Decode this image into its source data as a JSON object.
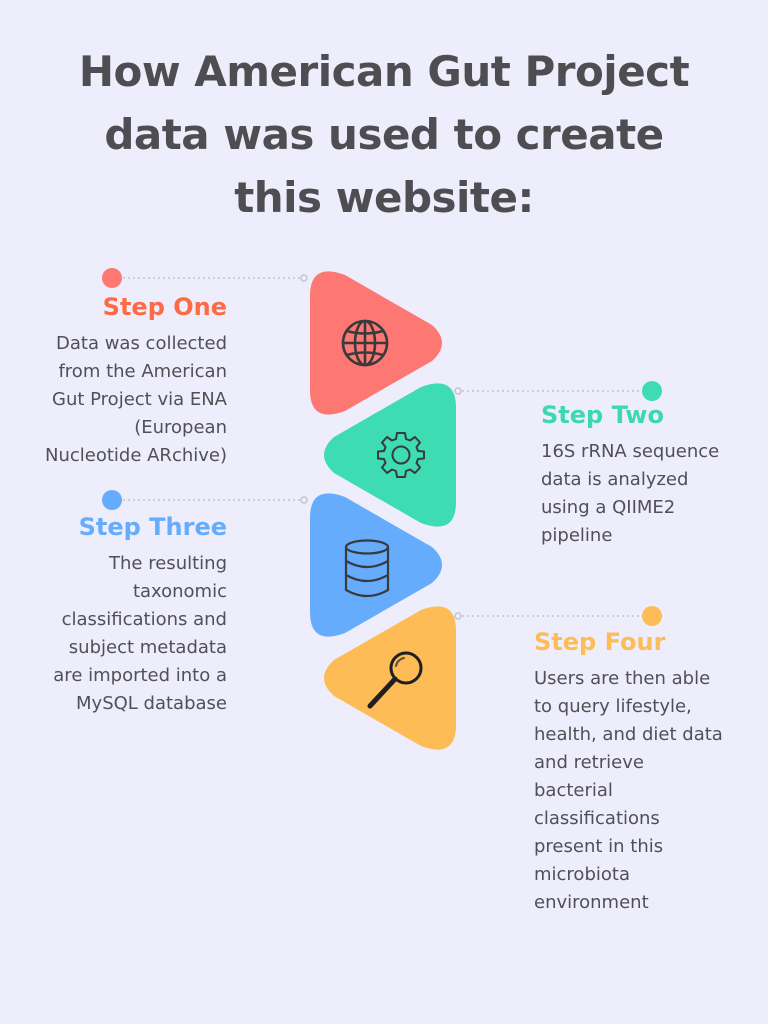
{
  "title": {
    "lines": [
      "How American Gut Project",
      "data was used to create",
      "this website:"
    ]
  },
  "colors": {
    "background": "#eeedfc",
    "title": "#4e4e52",
    "text": "#505055"
  },
  "steps": [
    {
      "title": "Step One",
      "color": "#fe7873",
      "title_color": "#fd6a43",
      "icon": "globe-icon",
      "lines": [
        "Data was collected",
        "from the American",
        "Gut Project via ENA",
        "(European",
        "Nucleotide ARchive)"
      ]
    },
    {
      "title": "Step Two",
      "color": "#3ddcb2",
      "title_color": "#3dd8b0",
      "icon": "gear-icon",
      "lines": [
        "16S rRNA sequence",
        "data is analyzed",
        "using a QIIME2",
        "pipeline"
      ]
    },
    {
      "title": "Step Three",
      "color": "#65acfd",
      "title_color": "#65acfd",
      "icon": "database-icon",
      "lines": [
        "The resulting",
        "taxonomic",
        "classifications and",
        "subject metadata",
        "are imported into a",
        "MySQL database"
      ]
    },
    {
      "title": "Step Four",
      "color": "#fdbc56",
      "title_color": "#fdbc56",
      "icon": "magnifier-icon",
      "lines": [
        "Users are then able",
        "to query lifestyle,",
        "health, and diet data",
        "and retrieve",
        "bacterial",
        "classifications",
        "present in this",
        "microbiota",
        "environment"
      ]
    }
  ]
}
